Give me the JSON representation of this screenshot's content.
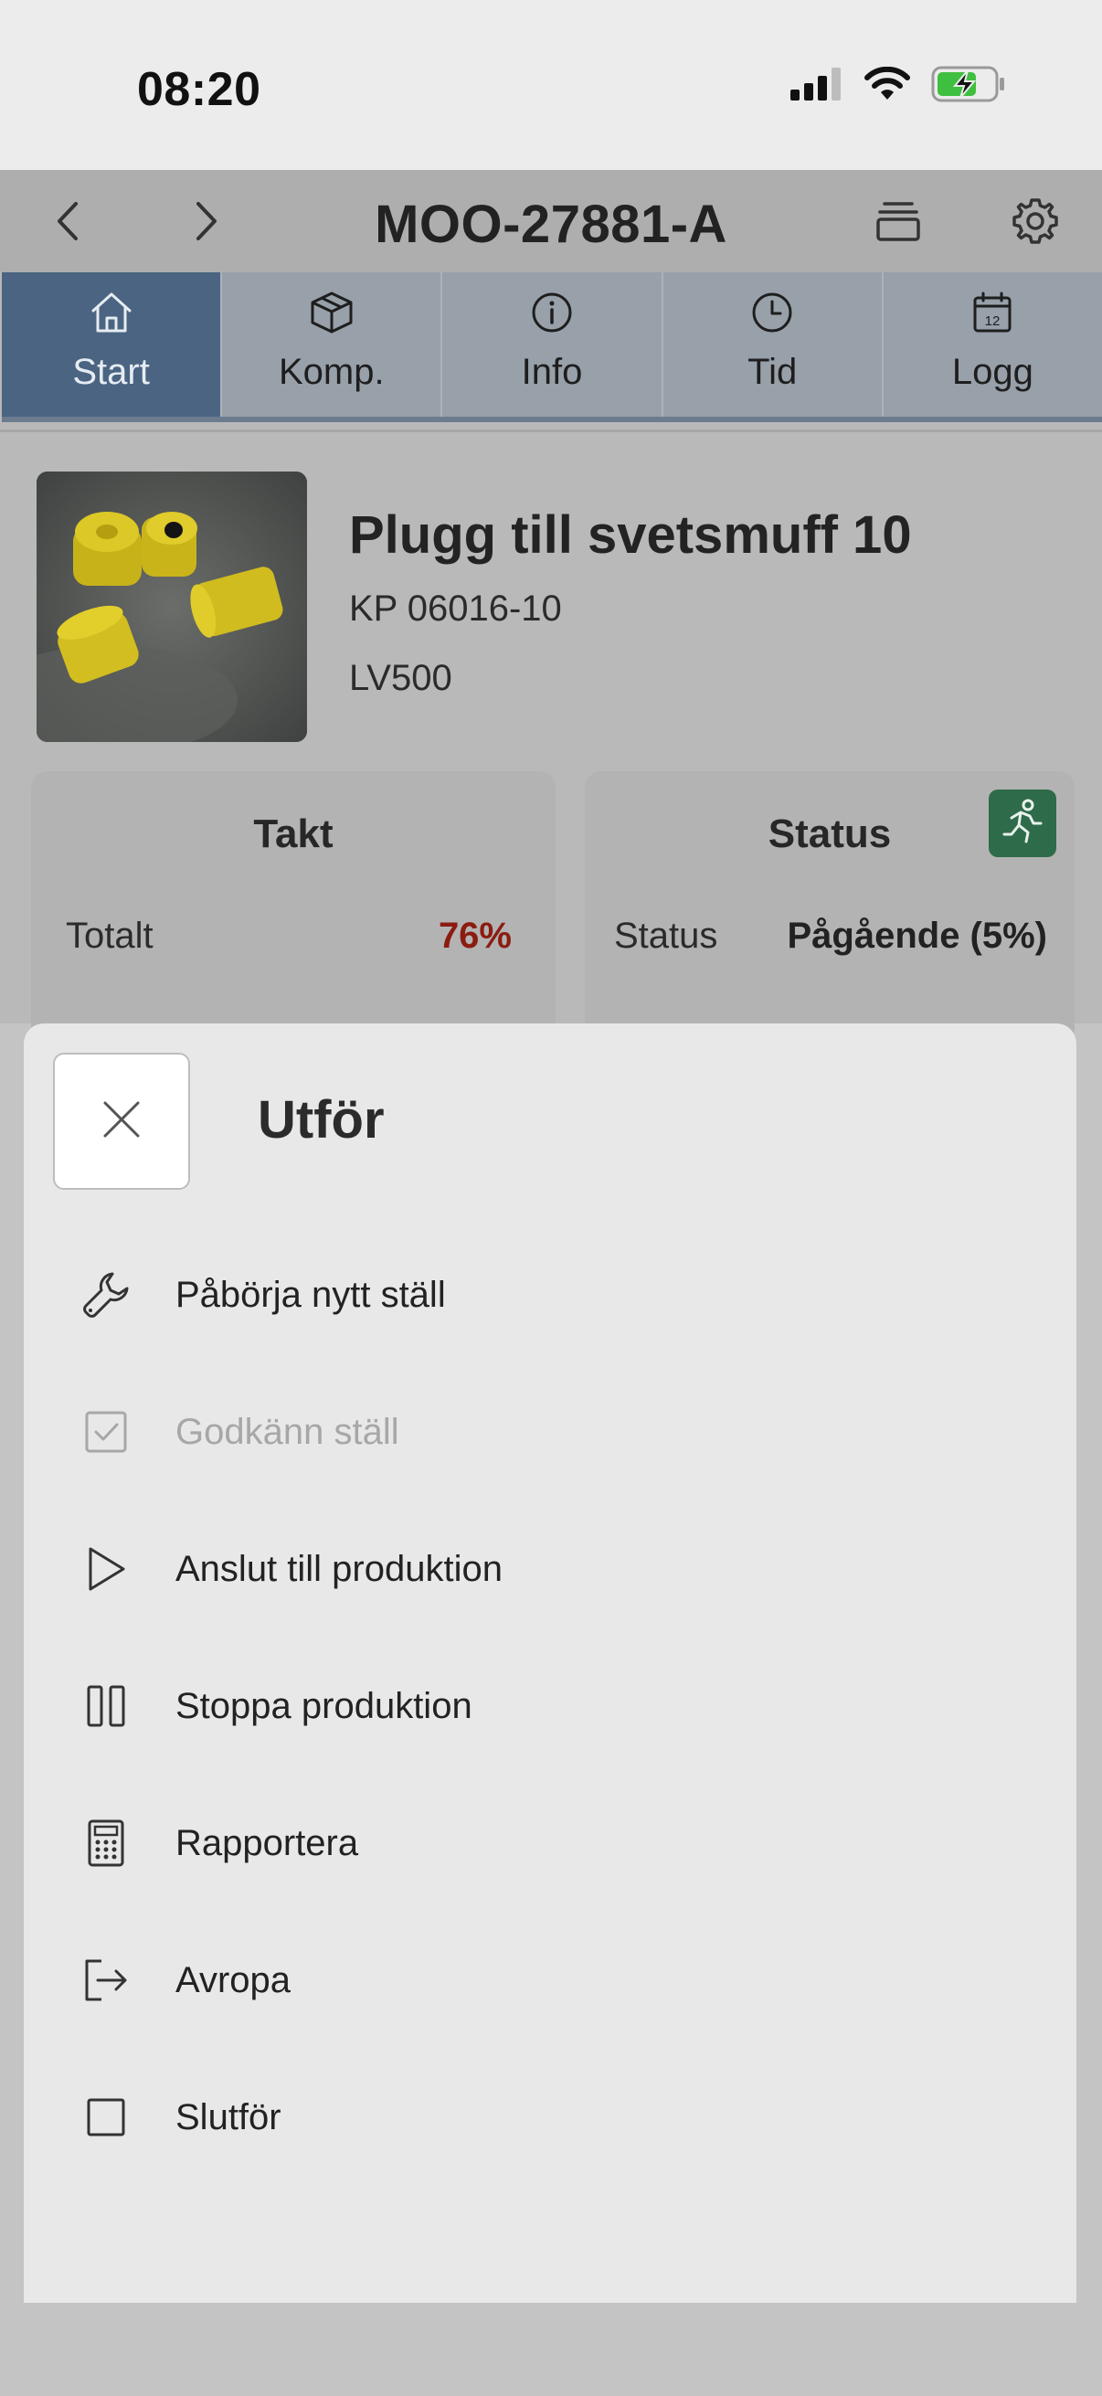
{
  "status_bar": {
    "time": "08:20"
  },
  "navbar": {
    "title": "MOO-27881-A"
  },
  "tabs": [
    {
      "label": "Start",
      "icon": "home-icon",
      "active": true
    },
    {
      "label": "Komp.",
      "icon": "box-icon",
      "active": false
    },
    {
      "label": "Info",
      "icon": "info-icon",
      "active": false
    },
    {
      "label": "Tid",
      "icon": "clock-icon",
      "active": false
    },
    {
      "label": "Logg",
      "icon": "calendar-icon",
      "active": false
    }
  ],
  "product": {
    "name": "Plugg till svetsmuff 10",
    "code": "KP 06016-10",
    "line": "LV500"
  },
  "cards": {
    "takt": {
      "title": "Takt",
      "row_label": "Totalt",
      "row_value": "76%",
      "value_color": "#8b1c10"
    },
    "status": {
      "title": "Status",
      "row_label": "Status",
      "row_value": "Pågående (5%)",
      "badge_color": "#2e6b4a"
    }
  },
  "sheet": {
    "title": "Utför",
    "items": [
      {
        "label": "Påbörja nytt ställ",
        "icon": "wrench-icon",
        "enabled": true
      },
      {
        "label": "Godkänn ställ",
        "icon": "checkbox-checked-icon",
        "enabled": false
      },
      {
        "label": "Anslut till produktion",
        "icon": "play-icon",
        "enabled": true
      },
      {
        "label": "Stoppa produktion",
        "icon": "pause-icon",
        "enabled": true
      },
      {
        "label": "Rapportera",
        "icon": "calculator-icon",
        "enabled": true
      },
      {
        "label": "Avropa",
        "icon": "exit-icon",
        "enabled": true
      },
      {
        "label": "Slutför",
        "icon": "checkbox-empty-icon",
        "enabled": true
      }
    ]
  }
}
